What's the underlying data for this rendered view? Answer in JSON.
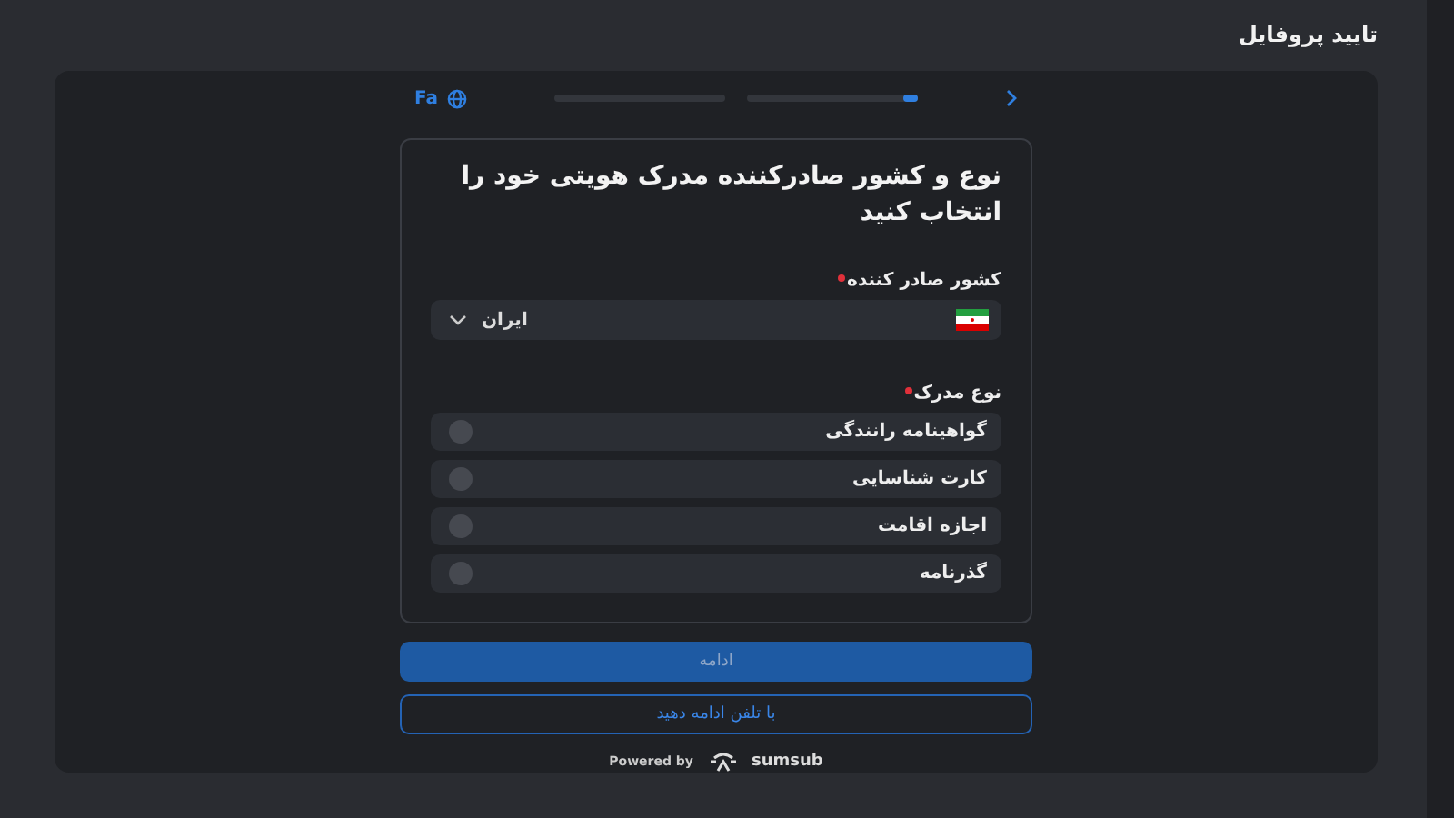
{
  "header": {
    "title": "تایید پروفایل"
  },
  "top_bar": {
    "language": "Fa",
    "progress": {
      "level": 0.08
    }
  },
  "card": {
    "title": "نوع و کشور صادرکننده مدرک هویتی خود را انتخاب کنید",
    "country": {
      "label": "کشور صادر کننده",
      "required": true,
      "value": "ایران"
    },
    "document": {
      "label": "نوع مدرک",
      "required": true,
      "options": [
        {
          "label": "گواهینامه رانندگی",
          "selected": false
        },
        {
          "label": "کارت شناسایی",
          "selected": false
        },
        {
          "label": "اجازه اقامت",
          "selected": false
        },
        {
          "label": "گذرنامه",
          "selected": false
        }
      ]
    }
  },
  "buttons": [
    {
      "kind": "primary",
      "label": "ادامه",
      "disabled": true
    },
    {
      "kind": "outline",
      "label": "با تلفن ادامه دهید"
    }
  ],
  "footer": {
    "powered_by": "Powered by",
    "brand": "sumsub"
  }
}
